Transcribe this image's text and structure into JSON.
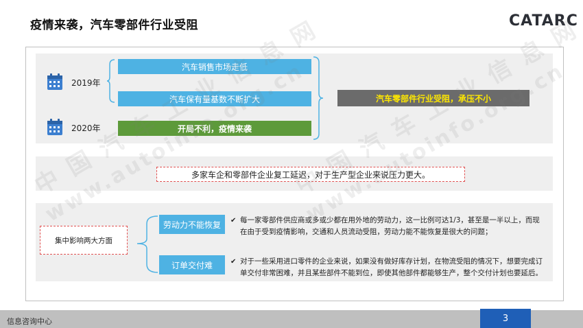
{
  "title": "疫情来袭，汽车零部件行业受阻",
  "logo": "CATARC",
  "timeline": [
    {
      "year": "2019年"
    },
    {
      "year": "2020年"
    }
  ],
  "bars": {
    "b1": "汽车销售市场走低",
    "b2": "汽车保有量基数不断扩大",
    "b3": "开局不利，疫情来袭",
    "result": "汽车零部件行业受阻，承压不小"
  },
  "middle_text": "多家车企和零部件企业复工延迟，对于生产型企业来说压力更大。",
  "impact": {
    "label": "集中影响两大方面",
    "items": [
      {
        "tag": "劳动力不能恢复",
        "check": "✔",
        "text_line1": "每一家零部件供应商或多或少都在用外地的劳动力，这一比例可达1/3，甚至是一半以上，而现",
        "text_line2": "在由于受到疫情影响，交通和人员流动受阻，劳动力能不能恢复是很大的问题；"
      },
      {
        "tag": "订单交付难",
        "check": "✔",
        "text_line1": "对于一些采用进口零件的企业来说，如果没有做好库存计划，在物流受阻的情况下，想要完成订",
        "text_line2": "单交付非常困难，并且某些部件不能到位，即使其他部件都能够生产，整个交付计划也要延后。"
      }
    ]
  },
  "footer": {
    "left": "信息咨询中心",
    "page": "3"
  },
  "watermarks": {
    "w1": "中 国 汽 车 工 业 信 息 网",
    "w2": "www.autoinfo.org.cn",
    "w3": "中 国 汽 车 工 业 信 息 网",
    "w4": "www.autoinfo.org.cn"
  },
  "colors": {
    "accent_blue": "#4eb2e3",
    "green": "#5d9a3a",
    "dark_gray": "#6b6b6b",
    "highlight_yellow": "#ffe800",
    "page_blue": "#1f5fb7"
  }
}
